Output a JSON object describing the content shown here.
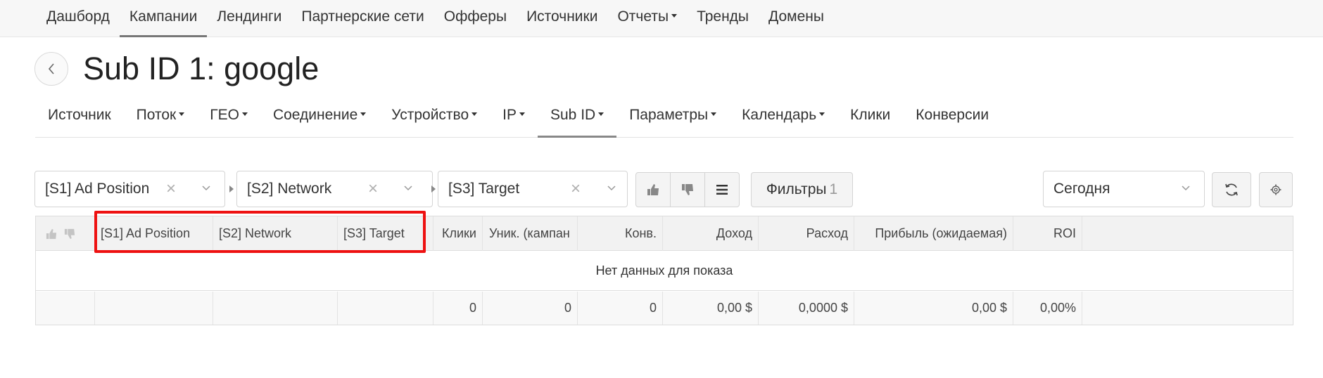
{
  "topnav": {
    "items": [
      {
        "label": "Дашборд"
      },
      {
        "label": "Кампании"
      },
      {
        "label": "Лендинги"
      },
      {
        "label": "Партнерские сети"
      },
      {
        "label": "Офферы"
      },
      {
        "label": "Источники"
      },
      {
        "label": "Отчеты"
      },
      {
        "label": "Тренды"
      },
      {
        "label": "Домены"
      }
    ]
  },
  "page": {
    "title": "Sub ID 1: google"
  },
  "subtabs": [
    {
      "label": "Источник"
    },
    {
      "label": "Поток"
    },
    {
      "label": "ГЕО"
    },
    {
      "label": "Соединение"
    },
    {
      "label": "Устройство"
    },
    {
      "label": "IP"
    },
    {
      "label": "Sub ID"
    },
    {
      "label": "Параметры"
    },
    {
      "label": "Календарь"
    },
    {
      "label": "Клики"
    },
    {
      "label": "Конверсии"
    }
  ],
  "toolbar": {
    "group1": "[S1] Ad Position",
    "group2": "[S2] Network",
    "group3": "[S3] Target",
    "filters_label": "Фильтры",
    "filters_count": "1",
    "period": "Сегодня"
  },
  "table": {
    "headers": {
      "s1": "[S1] Ad Position",
      "s2": "[S2] Network",
      "s3": "[S3] Target",
      "clicks": "Клики",
      "unique": "Уник. (кампан",
      "conv": "Конв.",
      "revenue": "Доход",
      "cost": "Расход",
      "profit": "Прибыль (ожидаемая)",
      "roi": "ROI"
    },
    "empty_message": "Нет данных для показа",
    "totals": {
      "clicks": "0",
      "unique": "0",
      "conv": "0",
      "revenue": "0,00 $",
      "cost": "0,0000 $",
      "profit": "0,00 $",
      "roi": "0,00%"
    }
  },
  "colors": {
    "highlight": "#ee1111"
  }
}
